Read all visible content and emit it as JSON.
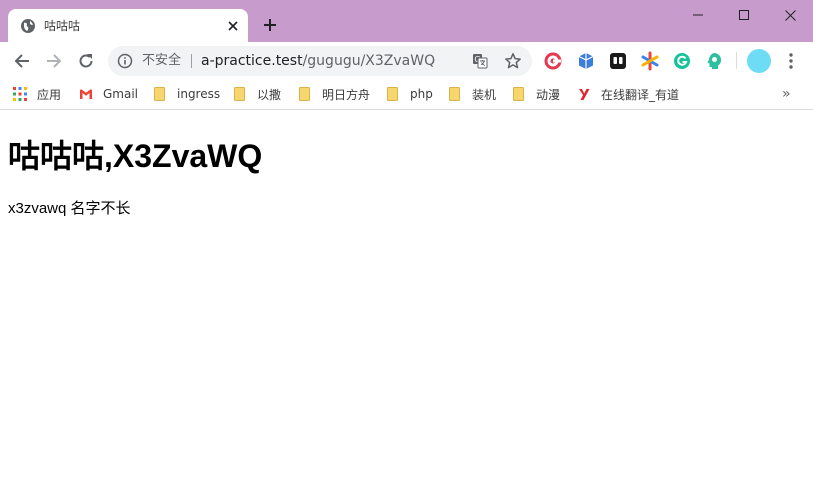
{
  "window": {
    "tab_title": "咕咕咕",
    "new_tab_symbol": "+"
  },
  "toolbar": {
    "security_label": "不安全",
    "url_host": "a-practice.test",
    "url_path": "/gugugu/X3ZvaWQ"
  },
  "bookmarks": {
    "items": [
      {
        "label": "应用",
        "icon": "apps-grid-icon"
      },
      {
        "label": "Gmail",
        "icon": "gmail-icon"
      },
      {
        "label": "ingress",
        "icon": "folder-icon"
      },
      {
        "label": "以撒",
        "icon": "folder-icon"
      },
      {
        "label": "明日方舟",
        "icon": "folder-icon"
      },
      {
        "label": "php",
        "icon": "folder-icon"
      },
      {
        "label": "装机",
        "icon": "folder-icon"
      },
      {
        "label": "动漫",
        "icon": "folder-icon"
      },
      {
        "label": "在线翻译_有道",
        "icon": "youdao-icon"
      }
    ],
    "overflow": "»"
  },
  "page": {
    "heading": "咕咕咕,X3ZvaWQ",
    "text": "x3zvawq 名字不长"
  },
  "colors": {
    "titlebar": "#c79ccc",
    "avatar": "#6fdcf5"
  }
}
